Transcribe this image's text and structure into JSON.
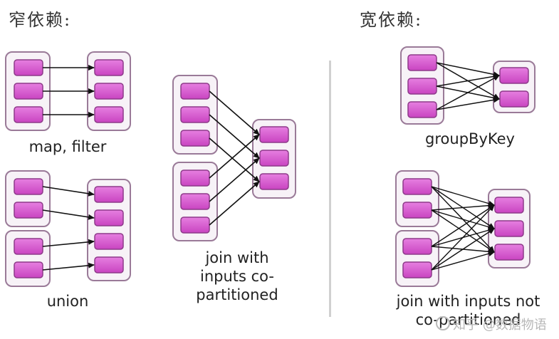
{
  "narrow": {
    "title": "窄依赖:",
    "diagrams": [
      {
        "caption": "map, filter"
      },
      {
        "caption": "union"
      },
      {
        "caption_lines": [
          "join with",
          "inputs co-",
          "partitioned"
        ]
      }
    ]
  },
  "wide": {
    "title": "宽依赖:",
    "diagrams": [
      {
        "caption": "groupByKey"
      },
      {
        "caption_lines": [
          "join with inputs not",
          "co-partitioned"
        ]
      }
    ]
  },
  "watermark": "知乎 @数据物语",
  "colors": {
    "partition_fill": "#d85ad0",
    "partition_border": "#8e3a8a",
    "rdd_border": "#9a7a98",
    "rdd_fill": "#f7f2f7",
    "arrow": "#111111",
    "divider": "#d0d0d0"
  }
}
